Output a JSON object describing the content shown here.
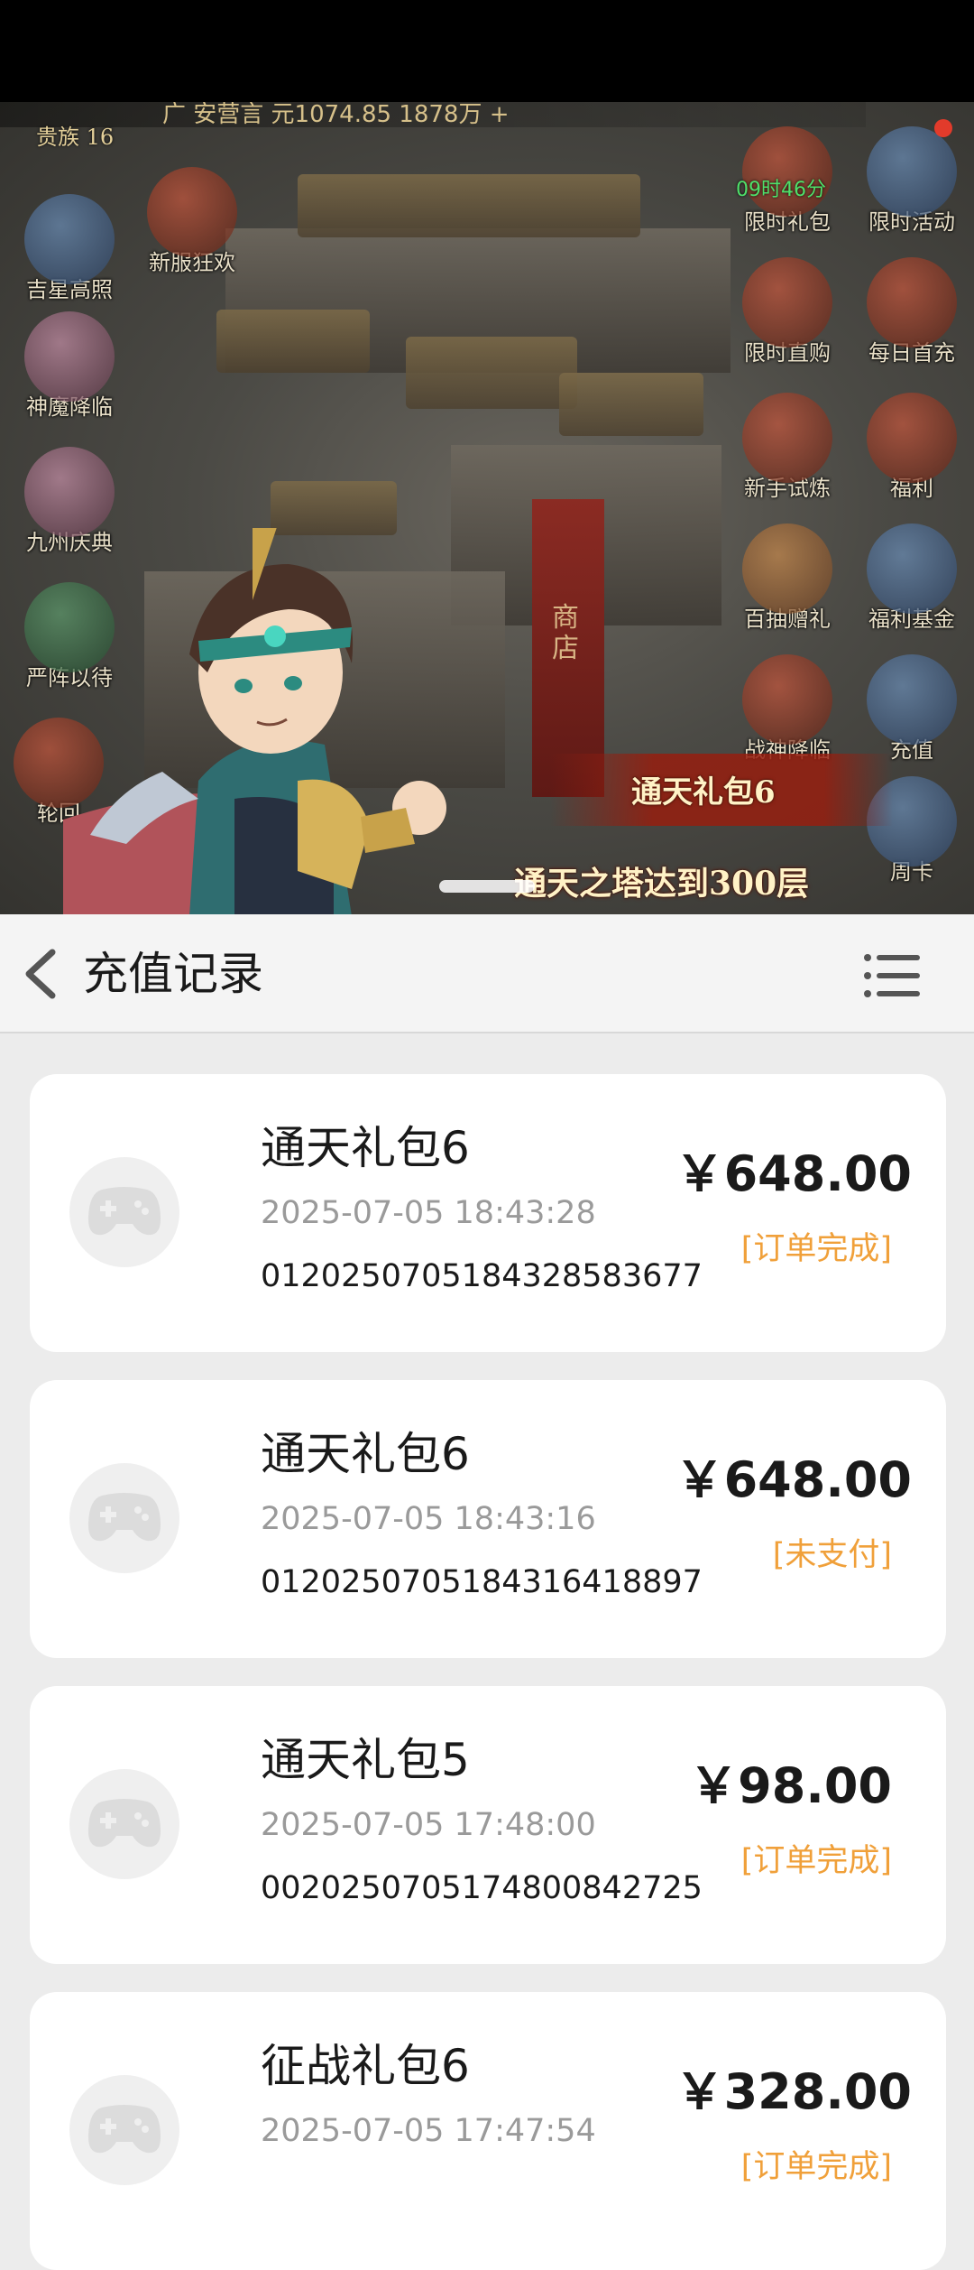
{
  "game": {
    "top_strip": "广 安营言  元1074.85  1878万  +",
    "noble_badge": "贵族 16",
    "timer": "09时46分",
    "shop_label": "商店",
    "promo_title": "通天礼包6",
    "promo_subtitle": "通天之塔达到300层",
    "left_icons": [
      {
        "label": "吉星高照",
        "icon": "lucky-star-icon"
      },
      {
        "label": "新服狂欢",
        "icon": "new-server-carnival-icon"
      },
      {
        "label": "神魔降临",
        "icon": "god-demon-icon"
      },
      {
        "label": "九州庆典",
        "icon": "celebration-icon"
      },
      {
        "label": "严阵以待",
        "icon": "battle-ready-icon"
      },
      {
        "label": "轮回",
        "icon": "reincarnation-icon"
      }
    ],
    "right_icons": [
      {
        "label": "限时礼包",
        "icon": "limited-gift-icon"
      },
      {
        "label": "限时活动",
        "icon": "limited-event-icon"
      },
      {
        "label": "限时直购",
        "icon": "limited-purchase-icon"
      },
      {
        "label": "每日首充",
        "icon": "daily-first-charge-icon"
      },
      {
        "label": "新手试炼",
        "icon": "novice-trial-icon"
      },
      {
        "label": "福利",
        "icon": "welfare-icon"
      },
      {
        "label": "百抽赠礼",
        "icon": "hundred-draw-gift-icon"
      },
      {
        "label": "福利基金",
        "icon": "welfare-fund-icon"
      },
      {
        "label": "战神降临",
        "icon": "war-god-icon"
      },
      {
        "label": "充值",
        "icon": "recharge-icon"
      },
      {
        "label": "周卡",
        "icon": "weekly-card-icon"
      }
    ]
  },
  "header": {
    "title": "充值记录"
  },
  "records": [
    {
      "name": "通天礼包6",
      "time": "2025-07-05 18:43:28",
      "order_id": "0120250705184328583677",
      "price": "￥648.00",
      "status": "[订单完成]"
    },
    {
      "name": "通天礼包6",
      "time": "2025-07-05 18:43:16",
      "order_id": "0120250705184316418897",
      "price": "￥648.00",
      "status": "[未支付]"
    },
    {
      "name": "通天礼包5",
      "time": "2025-07-05 17:48:00",
      "order_id": "0020250705174800842725",
      "price": "￥98.00",
      "status": "[订单完成]"
    },
    {
      "name": "征战礼包6",
      "time": "2025-07-05 17:47:54",
      "order_id": "",
      "price": "￥328.00",
      "status": "[订单完成]"
    }
  ],
  "colors": {
    "status_accent": "#f0a03a",
    "price_text": "#1a1a1a",
    "secondary_text": "#9a9a9a",
    "sheet_bg": "#ececec",
    "card_bg": "#ffffff"
  }
}
